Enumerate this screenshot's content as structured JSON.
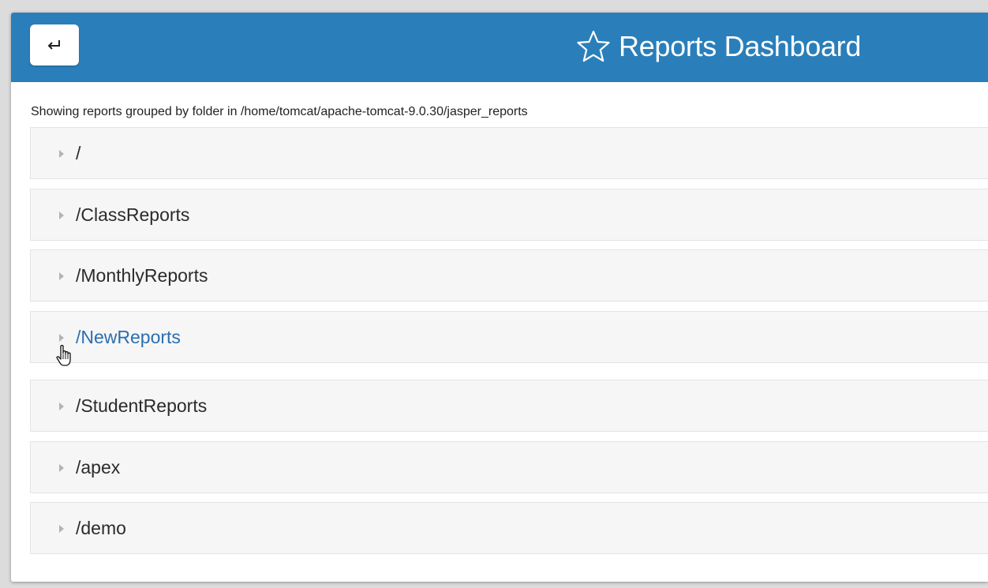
{
  "header": {
    "back_label": "↩",
    "title": "Reports Dashboard",
    "star_icon": "star-outline-icon",
    "accent_color": "#2a7fba"
  },
  "info": {
    "text": "Showing reports grouped by folder in /home/tomcat/apache-tomcat-9.0.30/jasper_reports"
  },
  "folders": [
    {
      "label": "/"
    },
    {
      "label": "/ClassReports"
    },
    {
      "label": "/MonthlyReports"
    },
    {
      "label": "/NewReports",
      "hovered": true,
      "link_color": "#2a6fb0"
    },
    {
      "label": "/StudentReports"
    },
    {
      "label": "/apex"
    },
    {
      "label": "/demo"
    }
  ]
}
